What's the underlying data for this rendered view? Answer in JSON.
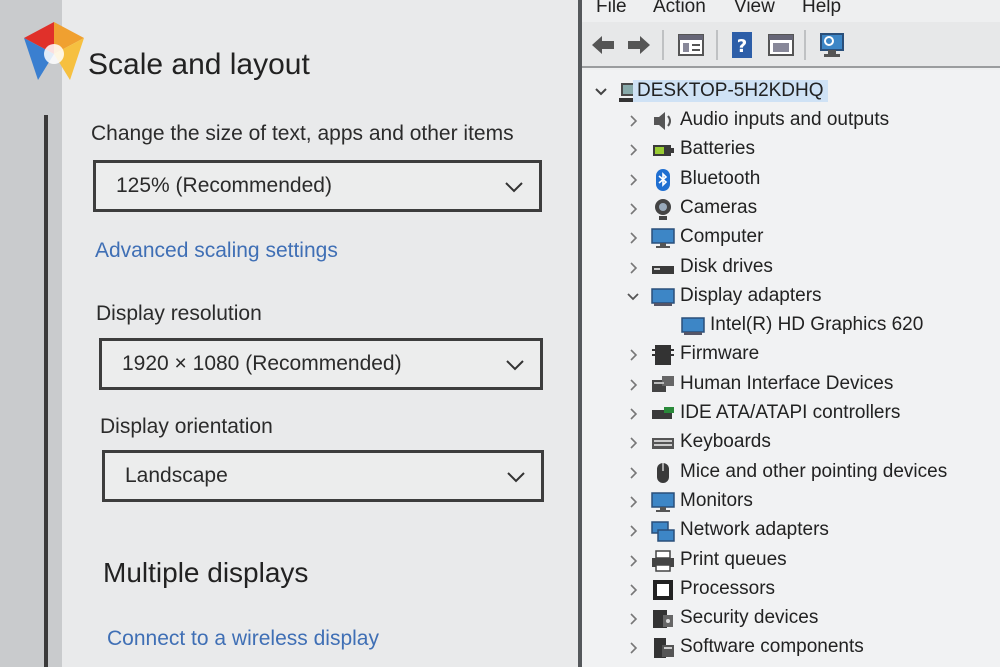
{
  "settings": {
    "scale_layout_title": "Scale and layout",
    "scale_label": "Change the size of text, apps and other items",
    "scale_value": "125% (Recommended)",
    "advanced_link": "Advanced scaling settings",
    "resolution_label": "Display resolution",
    "resolution_value": "1920 × 1080 (Recommended)",
    "orientation_label": "Display orientation",
    "orientation_value": "Landscape",
    "multiple_title": "Multiple displays",
    "wireless_link": "Connect to a wireless display"
  },
  "device_manager": {
    "menu": [
      "File",
      "Action",
      "View",
      "Help"
    ],
    "toolbar_icons": [
      "back-arrow-icon",
      "forward-arrow-icon",
      "properties-icon",
      "help-icon",
      "update-driver-icon",
      "scan-hardware-icon"
    ],
    "root": "DESKTOP-5H2KDHQ",
    "nodes": [
      {
        "label": "Audio inputs and outputs",
        "icon": "speaker-icon",
        "expanded": false
      },
      {
        "label": "Batteries",
        "icon": "battery-icon",
        "expanded": false
      },
      {
        "label": "Bluetooth",
        "icon": "bluetooth-icon",
        "expanded": false
      },
      {
        "label": "Cameras",
        "icon": "camera-icon",
        "expanded": false
      },
      {
        "label": "Computer",
        "icon": "monitor-icon",
        "expanded": false
      },
      {
        "label": "Disk drives",
        "icon": "disk-drive-icon",
        "expanded": false
      },
      {
        "label": "Display adapters",
        "icon": "display-adapter-icon",
        "expanded": true
      },
      {
        "label": "Intel(R) HD Graphics 620",
        "icon": "display-adapter-icon",
        "child": true
      },
      {
        "label": "Firmware",
        "icon": "firmware-icon",
        "expanded": false
      },
      {
        "label": "Human Interface Devices",
        "icon": "hid-icon",
        "expanded": false
      },
      {
        "label": "IDE ATA/ATAPI controllers",
        "icon": "ide-controller-icon",
        "expanded": false
      },
      {
        "label": "Keyboards",
        "icon": "keyboard-icon",
        "expanded": false
      },
      {
        "label": "Mice and other pointing devices",
        "icon": "mouse-icon",
        "expanded": false
      },
      {
        "label": "Monitors",
        "icon": "monitor-icon",
        "expanded": false
      },
      {
        "label": "Network adapters",
        "icon": "network-icon",
        "expanded": false
      },
      {
        "label": "Print queues",
        "icon": "printer-icon",
        "expanded": false
      },
      {
        "label": "Processors",
        "icon": "processor-icon",
        "expanded": false
      },
      {
        "label": "Security devices",
        "icon": "security-icon",
        "expanded": false
      },
      {
        "label": "Software components",
        "icon": "software-icon",
        "expanded": false
      }
    ]
  },
  "colors": {
    "link": "#3f6fb5",
    "selection": "#cfe2f5"
  }
}
